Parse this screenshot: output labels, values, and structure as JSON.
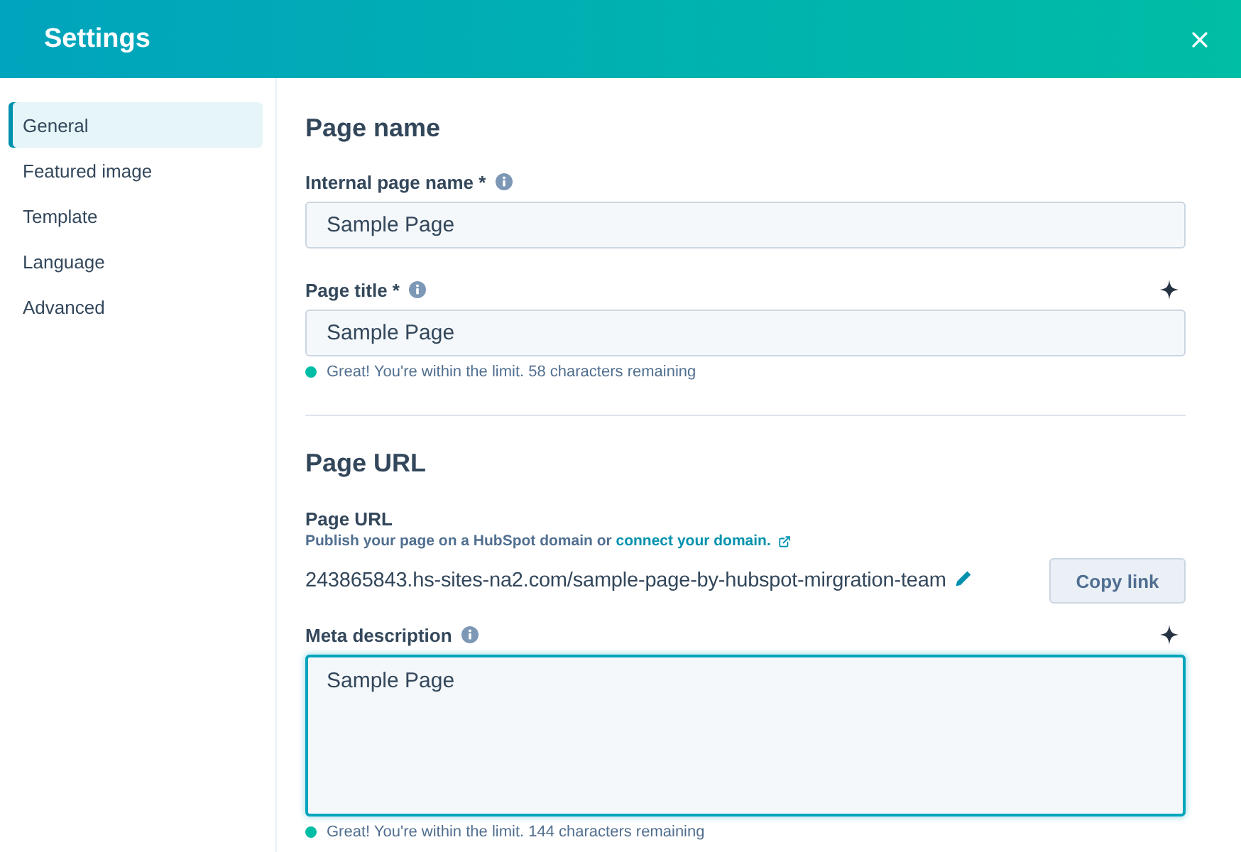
{
  "window": {
    "title": "Settings"
  },
  "sidebar": {
    "items": [
      {
        "label": "General",
        "selected": true
      },
      {
        "label": "Featured image",
        "selected": false
      },
      {
        "label": "Template",
        "selected": false
      },
      {
        "label": "Language",
        "selected": false
      },
      {
        "label": "Advanced",
        "selected": false
      }
    ]
  },
  "sections": [
    {
      "heading": "Page name",
      "fields": [
        {
          "kind": "input",
          "label": "Internal page name *",
          "info": true,
          "value": "Sample Page",
          "focused": false
        },
        {
          "kind": "input",
          "label": "Page title *",
          "info": true,
          "ai_assist": true,
          "value": "Sample Page",
          "focused": false,
          "status": {
            "kind": "success",
            "text": "Great! You're within the limit. 58 characters remaining"
          }
        }
      ]
    },
    {
      "heading": "Page URL",
      "fields": [
        {
          "kind": "url",
          "label": "Page URL",
          "help": "Publish your page on a HubSpot domain or",
          "help_link": "connect your domain.",
          "url": "243865843.hs-sites-na2.com/sample-page-by-hubspot-mirgration-team",
          "button": "Copy link"
        },
        {
          "kind": "textarea",
          "label": "Meta description",
          "info": true,
          "ai_assist": true,
          "value": "Sample Page",
          "focused": true,
          "status": {
            "kind": "success",
            "text": "Great! You're within the limit. 144 characters remaining"
          }
        }
      ]
    }
  ]
}
